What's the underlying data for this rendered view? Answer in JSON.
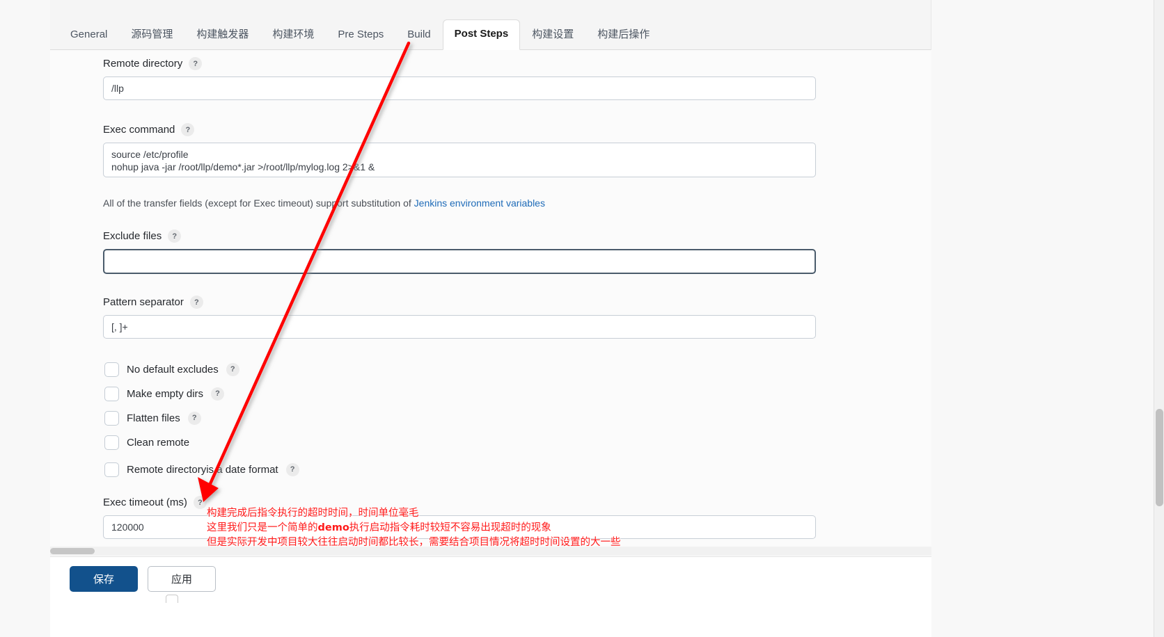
{
  "window": {
    "title": "Jenkins - Post Steps"
  },
  "tabs": [
    {
      "label": "General",
      "active": false
    },
    {
      "label": "源码管理",
      "active": false
    },
    {
      "label": "构建触发器",
      "active": false
    },
    {
      "label": "构建环境",
      "active": false
    },
    {
      "label": "Pre Steps",
      "active": false
    },
    {
      "label": "Build",
      "active": false
    },
    {
      "label": "Post Steps",
      "active": true
    },
    {
      "label": "构建设置",
      "active": false
    },
    {
      "label": "构建后操作",
      "active": false
    }
  ],
  "form": {
    "remote_directory": {
      "label": "Remote directory",
      "help": "?",
      "value": "/llp"
    },
    "exec_command": {
      "label": "Exec command",
      "help": "?",
      "value": "source /etc/profile\nnohup java -jar /root/llp/demo*.jar >/root/llp/mylog.log 2>&1 &"
    },
    "transfer_hint": {
      "text_before": "All of the transfer fields (except for Exec timeout) support substitution of ",
      "link_text": "Jenkins environment variables",
      "text_after": ""
    },
    "exclude_files": {
      "label": "Exclude files",
      "help": "?",
      "value": "",
      "focused": true
    },
    "pattern_separator": {
      "label": "Pattern separator",
      "help": "?",
      "value": "[, ]+"
    },
    "checkboxes": [
      {
        "label": "No default excludes",
        "checked": false,
        "help": "?"
      },
      {
        "label": "Make empty dirs",
        "checked": false,
        "help": "?"
      },
      {
        "label": "Flatten files",
        "checked": false,
        "help": "?"
      },
      {
        "label": "Clean remote",
        "checked": false,
        "help": ""
      },
      {
        "label": "Remote directoryis a date format",
        "checked": false,
        "help": "?"
      }
    ],
    "exec_timeout": {
      "label": "Exec timeout (ms)",
      "help": "?",
      "value": "120000"
    }
  },
  "buttons": {
    "save": "保存",
    "apply": "应用"
  },
  "annotation": {
    "color": "#ff1a1a",
    "line1": "构建完成后指令执行的超时时间，时间单位毫毛",
    "line2_a": "这里我们只是一个简单的",
    "line2_b": "demo",
    "line2_c": "执行启动指令耗时较短不容易出现超时的现象",
    "line3": "但是实际开发中项目较大往往启动时间都比较长，需要结合项目情况将超时时间设置的大一些"
  },
  "colors": {
    "accent_blue": "#12518c",
    "link_blue": "#1e6bb8",
    "annotation_red": "#ff1a1a",
    "card_bg": "#fbfbfb",
    "tab_bar_bg": "#f5f5f5"
  }
}
